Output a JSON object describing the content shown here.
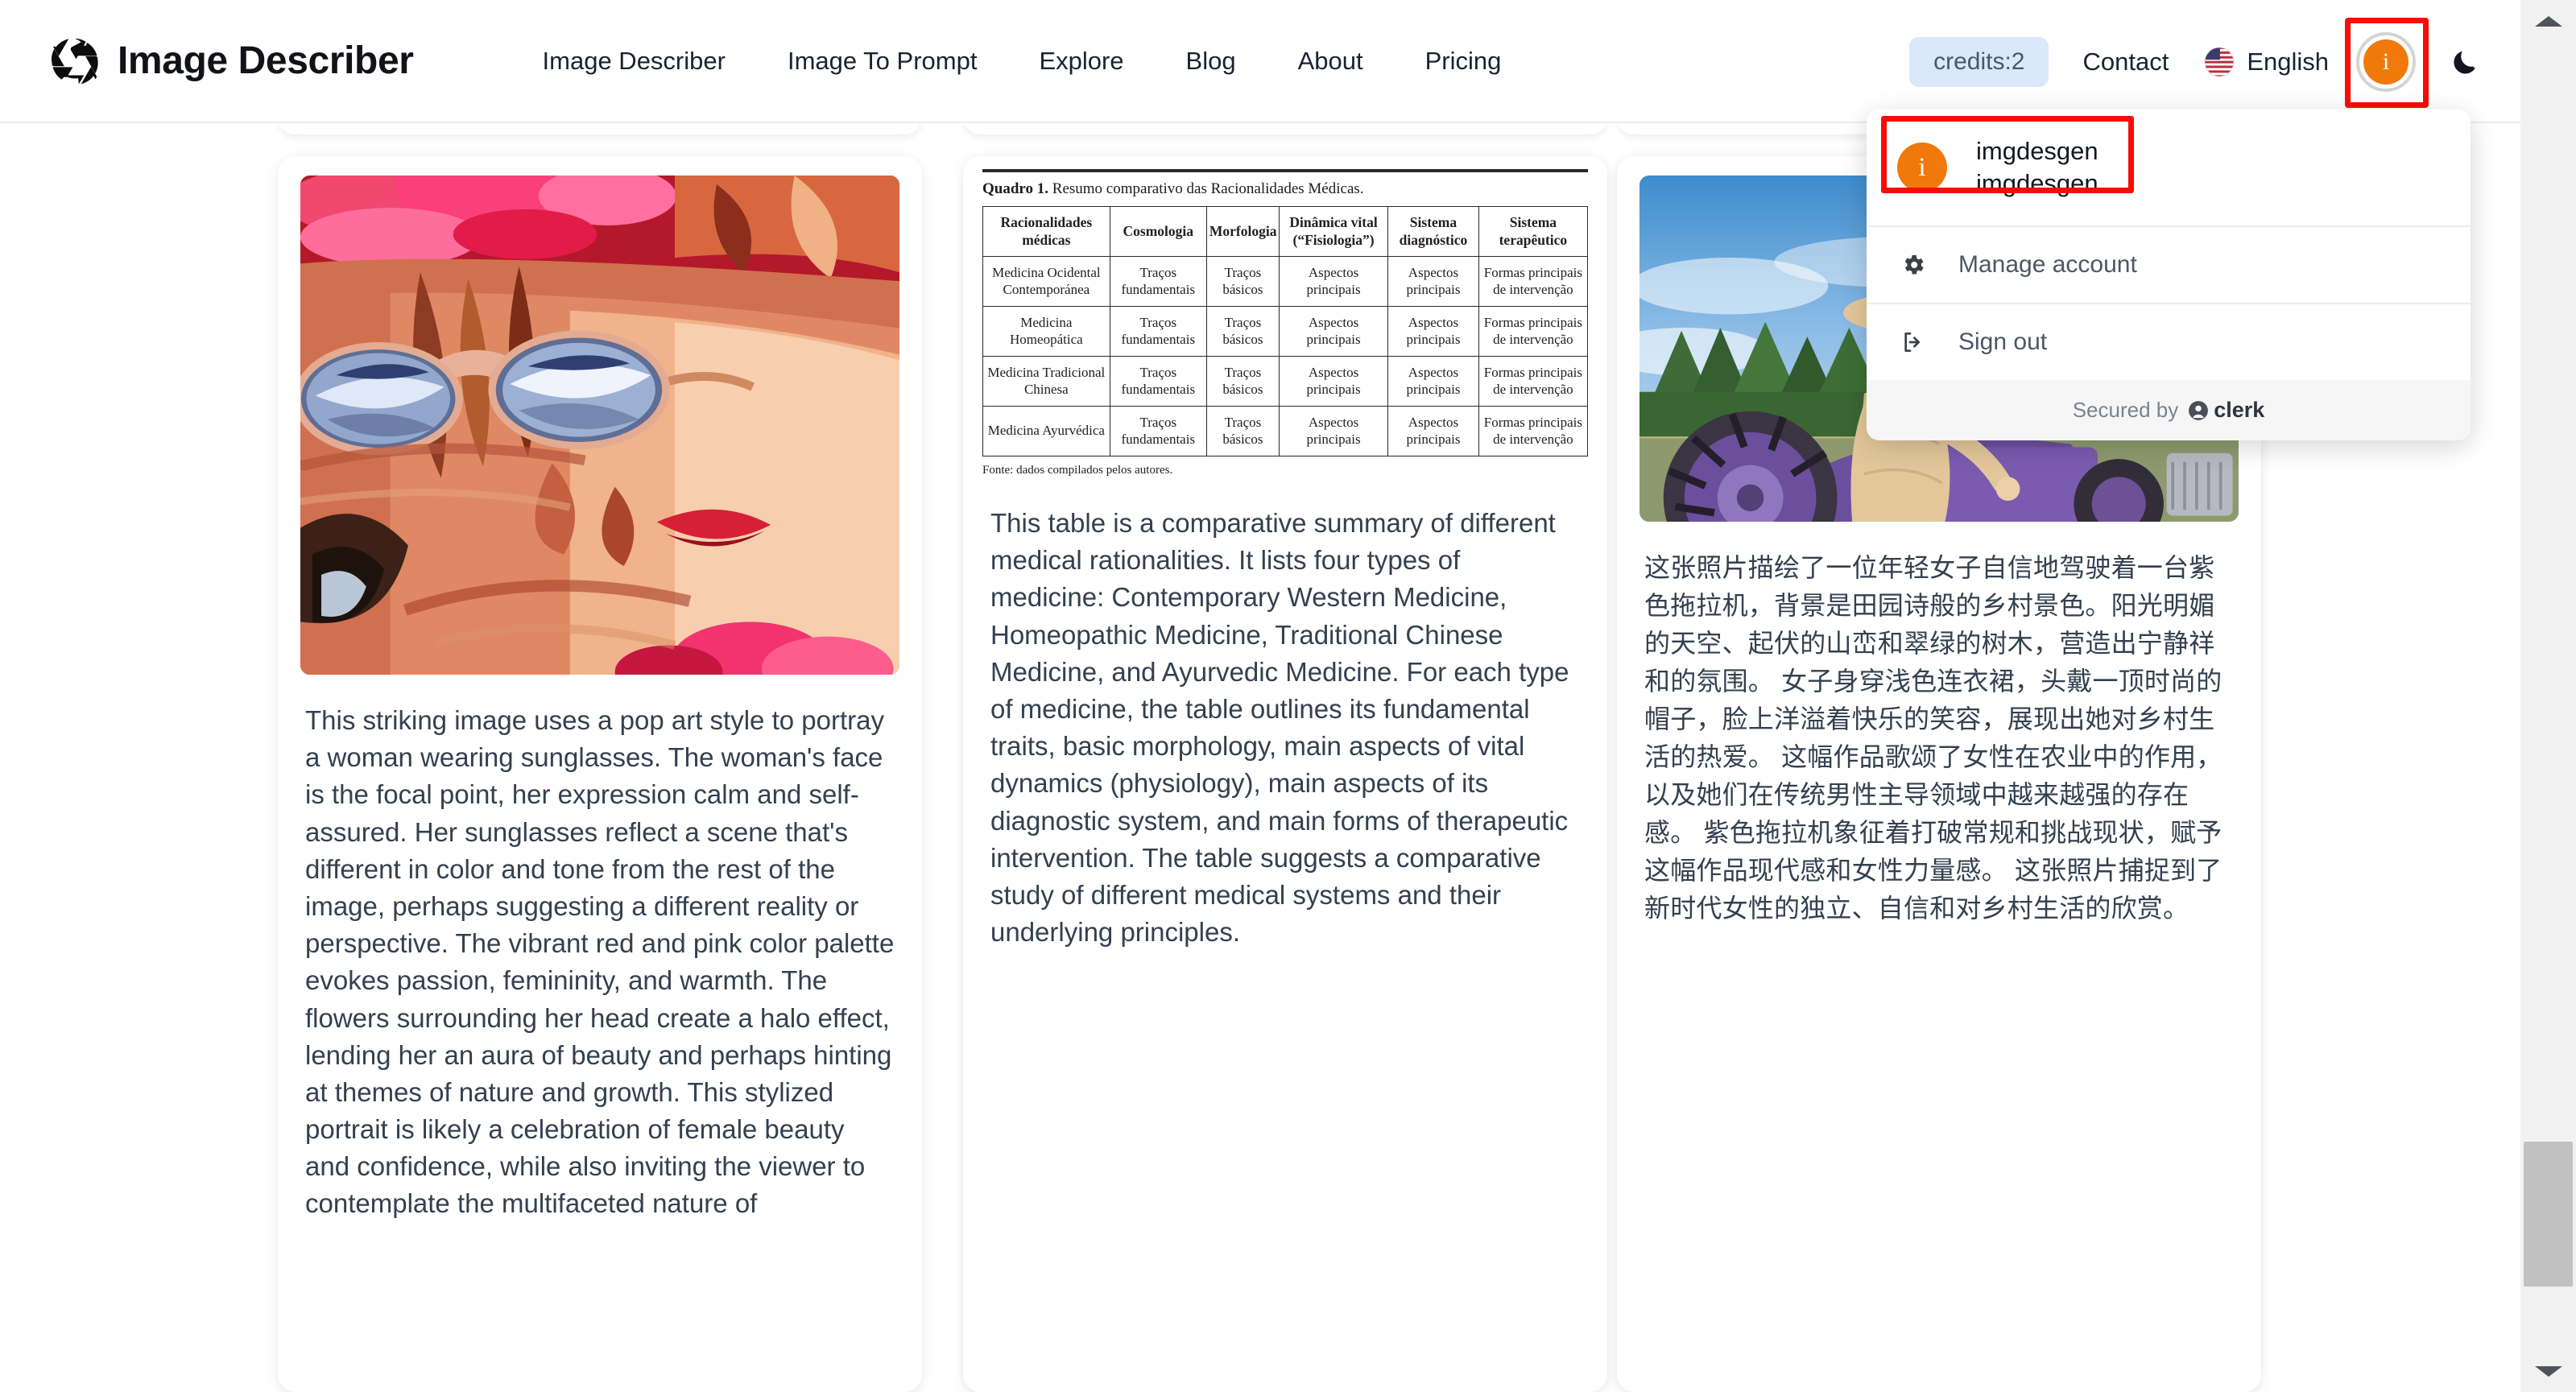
{
  "header": {
    "brand_title": "Image Describer",
    "brand_icon": "aperture-icon",
    "nav": [
      {
        "label": "Image Describer"
      },
      {
        "label": "Image To Prompt"
      },
      {
        "label": "Explore"
      },
      {
        "label": "Blog"
      },
      {
        "label": "About"
      },
      {
        "label": "Pricing"
      }
    ],
    "credits_label": "credits:2",
    "contact_label": "Contact",
    "language_label": "English",
    "language_flag_icon": "us-flag-icon",
    "avatar_initial": "i",
    "theme_toggle_icon": "moon-icon"
  },
  "user_menu": {
    "avatar_initial": "i",
    "account_name": "imgdesgen",
    "account_handle": "imgdesgen",
    "manage_account_label": "Manage account",
    "manage_account_icon": "gear-icon",
    "sign_out_label": "Sign out",
    "sign_out_icon": "sign-out-icon",
    "secured_by_label": "Secured by",
    "secured_by_provider": "clerk",
    "secured_by_icon": "clerk-logo-icon"
  },
  "cards": [
    {
      "image_alt": "pop-art-woman-sunglasses",
      "description": "This striking image uses a pop art style to portray a woman wearing sunglasses. The woman's face is the focal point, her expression calm and self-assured. Her sunglasses reflect a scene that's different in color and tone from the rest of the image, perhaps suggesting a different reality or perspective. The vibrant red and pink color palette evokes passion, femininity, and warmth. The flowers surrounding her head create a halo effect, lending her an aura of beauty and perhaps hinting at themes of nature and growth. This stylized portrait is likely a celebration of female beauty and confidence, while also inviting the viewer to contemplate the multifaceted nature of"
    },
    {
      "image_alt": "comparative-medical-rationalities-table",
      "description": "This table is a comparative summary of different medical rationalities. It lists four types of medicine: Contemporary Western Medicine, Homeopathic Medicine, Traditional Chinese Medicine, and Ayurvedic Medicine. For each type of medicine, the table outlines its fundamental traits, basic morphology, main aspects of vital dynamics (physiology), main aspects of its diagnostic system, and main forms of therapeutic intervention. The table suggests a comparative study of different medical systems and their underlying principles."
    },
    {
      "image_alt": "woman-on-purple-tractor",
      "description": "这张照片描绘了一位年轻女子自信地驾驶着一台紫色拖拉机，背景是田园诗般的乡村景色。阳光明媚的天空、起伏的山峦和翠绿的树木，营造出宁静祥和的氛围。 女子身穿浅色连衣裙，头戴一顶时尚的帽子，脸上洋溢着快乐的笑容，展现出她对乡村生活的热爱。 这幅作品歌颂了女性在农业中的作用，以及她们在传统男性主导领域中越来越强的存在感。 紫色拖拉机象征着打破常规和挑战现状，赋予这幅作品现代感和女性力量感。 这张照片捕捉到了新时代女性的独立、自信和对乡村生活的欣赏。"
    }
  ],
  "figure": {
    "caption_label": "Quadro 1.",
    "caption_text": "Resumo comparativo das Racionalidades Médicas.",
    "source": "Fonte: dados compilados pelos autores.",
    "headers": [
      "Racionalidades médicas",
      "Cosmologia",
      "Morfologia",
      "Dinâmica vital (“Fisiologia”)",
      "Sistema diagnóstico",
      "Sistema terapêutico"
    ],
    "rows": [
      [
        "Medicina Ocidental Contemporánea",
        "Traços fundamentais",
        "Traços básicos",
        "Aspectos principais",
        "Aspectos principais",
        "Formas principais de intervenção"
      ],
      [
        "Medicina Homeopática",
        "Traços fundamentais",
        "Traços básicos",
        "Aspectos principais",
        "Aspectos principais",
        "Formas principais de intervenção"
      ],
      [
        "Medicina Tradicional Chinesa",
        "Traços fundamentais",
        "Traços básicos",
        "Aspectos principais",
        "Aspectos principais",
        "Formas principais de intervenção"
      ],
      [
        "Medicina Ayurvédica",
        "Traços fundamentais",
        "Traços básicos",
        "Aspectos principais",
        "Aspectos principais",
        "Formas principais de intervenção"
      ]
    ]
  },
  "colors": {
    "accent_orange": "#f1790b",
    "highlight_red": "#fa0c06",
    "credits_badge_bg": "#dbe8fb",
    "text_primary": "#1b2230",
    "text_body": "#33404f"
  }
}
